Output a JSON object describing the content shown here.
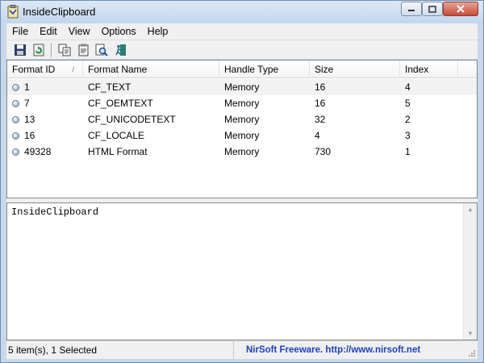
{
  "window": {
    "title": "InsideClipboard"
  },
  "menu": [
    "File",
    "Edit",
    "View",
    "Options",
    "Help"
  ],
  "toolbar": {
    "buttons": [
      {
        "icon": "save-icon"
      },
      {
        "icon": "refresh-icon"
      },
      {
        "icon": "copy-icon"
      },
      {
        "icon": "properties-icon"
      },
      {
        "icon": "find-icon"
      },
      {
        "icon": "exit-icon"
      }
    ]
  },
  "list": {
    "columns": [
      "Format ID",
      "Format Name",
      "Handle Type",
      "Size",
      "Index"
    ],
    "sort_indicator": "/",
    "rows": [
      {
        "id": "1",
        "name": "CF_TEXT",
        "handle": "Memory",
        "size": "16",
        "index": "4",
        "selected": true
      },
      {
        "id": "7",
        "name": "CF_OEMTEXT",
        "handle": "Memory",
        "size": "16",
        "index": "5",
        "selected": false
      },
      {
        "id": "13",
        "name": "CF_UNICODETEXT",
        "handle": "Memory",
        "size": "32",
        "index": "2",
        "selected": false
      },
      {
        "id": "16",
        "name": "CF_LOCALE",
        "handle": "Memory",
        "size": "4",
        "index": "3",
        "selected": false
      },
      {
        "id": "49328",
        "name": "HTML Format",
        "handle": "Memory",
        "size": "730",
        "index": "1",
        "selected": false
      }
    ]
  },
  "preview": {
    "text": "InsideClipboard"
  },
  "status": {
    "items": "5 item(s), 1 Selected",
    "link": "NirSoft Freeware.  http://www.nirsoft.net"
  },
  "colors": {
    "link": "#1a3fc4",
    "selected_row": "#f2f2f2"
  }
}
